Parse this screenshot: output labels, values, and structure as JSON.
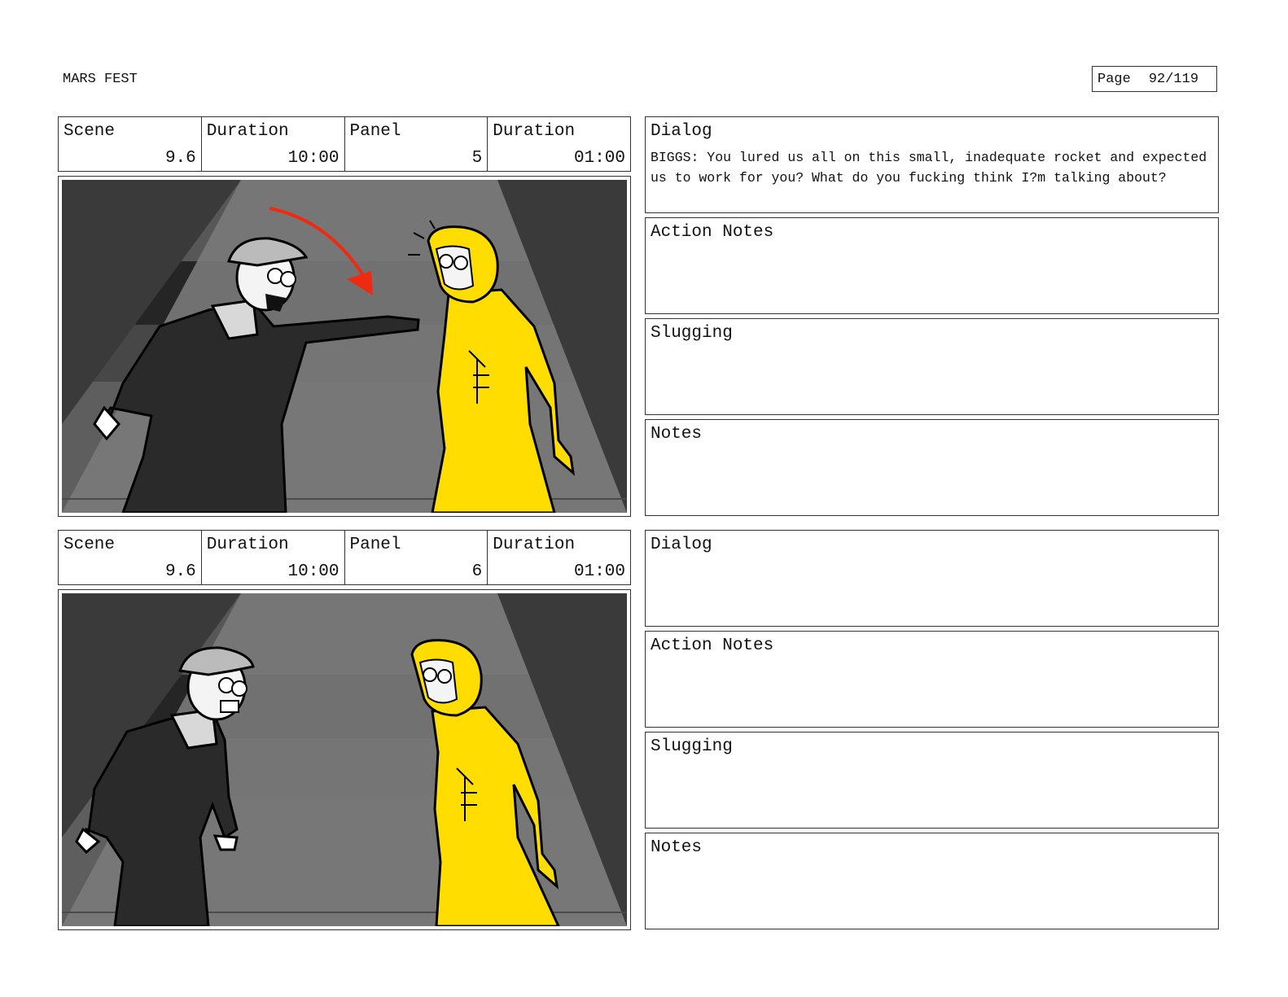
{
  "header": {
    "project_title": "MARS FEST",
    "page_label": "Page",
    "page_number": "92/119"
  },
  "panels": [
    {
      "scene_label": "Scene",
      "scene": "9.6",
      "scene_duration_label": "Duration",
      "scene_duration": "10:00",
      "panel_label": "Panel",
      "panel": "5",
      "panel_duration_label": "Duration",
      "panel_duration": "01:00",
      "dialog_label": "Dialog",
      "dialog": "BIGGS: You lured us all on this small, inadequate rocket and expected us to work for you? What do you fucking think I?m talking about?",
      "action_notes_label": "Action Notes",
      "action_notes": "",
      "slugging_label": "Slugging",
      "slugging": "",
      "notes_label": "Notes",
      "notes": ""
    },
    {
      "scene_label": "Scene",
      "scene": "9.6",
      "scene_duration_label": "Duration",
      "scene_duration": "10:00",
      "panel_label": "Panel",
      "panel": "6",
      "panel_duration_label": "Duration",
      "panel_duration": "01:00",
      "dialog_label": "Dialog",
      "dialog": "",
      "action_notes_label": "Action Notes",
      "action_notes": "",
      "slugging_label": "Slugging",
      "slugging": "",
      "notes_label": "Notes",
      "notes": ""
    }
  ],
  "colors": {
    "suit_yellow": "#ffdd00",
    "arrow_red": "#f02a10",
    "jumpsuit_black": "#2a2a2a"
  }
}
